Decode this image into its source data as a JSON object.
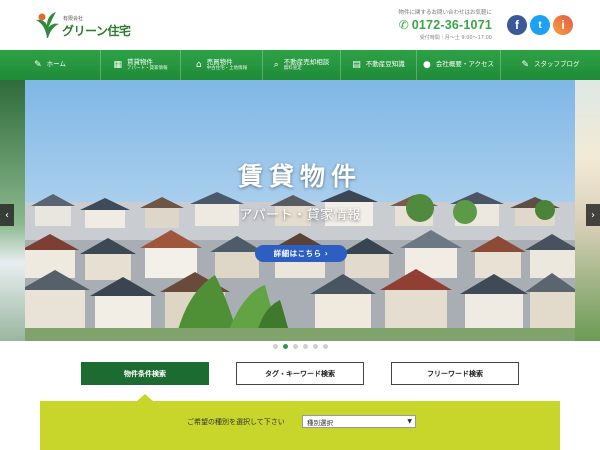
{
  "header": {
    "logo_small": "有限会社",
    "logo_name": "グリーン住宅",
    "contact_note": "物件に関するお問い合わせはお気軽に",
    "phone": "0172-36-1071",
    "hours": "受付時間｜月～土 9:00～17:00",
    "social": [
      "f",
      "t",
      "i"
    ]
  },
  "nav": [
    {
      "icon": "✎",
      "label": "ホーム",
      "sub": ""
    },
    {
      "icon": "▦",
      "label": "賃貸物件",
      "sub": "アパート・貸家情報"
    },
    {
      "icon": "⌂",
      "label": "売買物件",
      "sub": "中古住宅・土地情報"
    },
    {
      "icon": "⌕",
      "label": "不動産売却相談",
      "sub": "無料査定"
    },
    {
      "icon": "▤",
      "label": "不動産豆知識",
      "sub": ""
    },
    {
      "icon": "●",
      "label": "会社概要・アクセス",
      "sub": ""
    },
    {
      "icon": "✎",
      "label": "スタッフブログ",
      "sub": ""
    }
  ],
  "hero": {
    "title": "賃貸物件",
    "subtitle": "アパート・貸家情報",
    "button": "詳細はこちら ›",
    "arrow_left": "‹",
    "arrow_right": "›"
  },
  "slider": {
    "count": 6,
    "active_index": 1
  },
  "search_tabs": [
    {
      "label": "物件条件検索",
      "active": true
    },
    {
      "label": "タグ・キーワード検索",
      "active": false
    },
    {
      "label": "フリーワード検索",
      "active": false
    }
  ],
  "filter": {
    "label": "ご希望の種別を選択して下さい",
    "select_value": "種別選択"
  },
  "colors": {
    "brand_green": "#2ea247",
    "tab_active": "#1c6b30",
    "filter_band": "#c8d52a",
    "hero_button": "#2d5fc2"
  }
}
